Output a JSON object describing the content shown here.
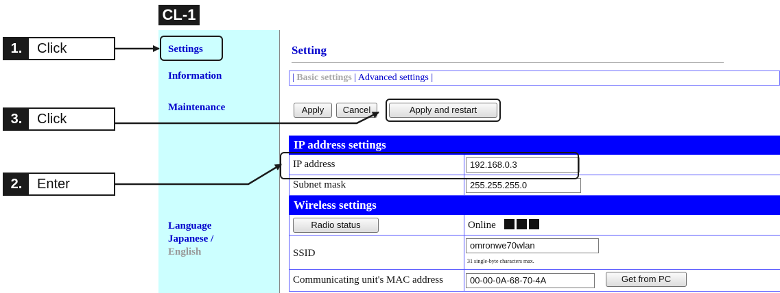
{
  "badge": {
    "label": "CL-1"
  },
  "steps": [
    {
      "num": "1.",
      "text": "Click"
    },
    {
      "num": "3.",
      "text": "Click"
    },
    {
      "num": "2.",
      "text": "Enter"
    }
  ],
  "sidebar": {
    "settings": "Settings",
    "information": "Information",
    "maintenance": "Maintenance",
    "language_label": "Language",
    "japanese": "Japanese",
    "lang_sep": " /",
    "english": "English"
  },
  "main": {
    "title": "Setting",
    "tabs": {
      "basic": "Basic settings",
      "advanced": "Advanced settings",
      "sep_left": "|",
      "sep_mid": " | ",
      "sep_right": " |"
    },
    "buttons": {
      "apply": "Apply",
      "cancel": "Cancel",
      "apply_restart": "Apply and restart"
    }
  },
  "ip_section": {
    "header": "IP address settings",
    "ip_label": "IP address",
    "ip_value": "192.168.0.3",
    "mask_label": "Subnet mask",
    "mask_value": "255.255.255.0"
  },
  "wireless_section": {
    "header": "Wireless settings",
    "radio_button": "Radio status",
    "radio_value": "Online",
    "ssid_label": "SSID",
    "ssid_value": "omronwe70wlan",
    "ssid_hint": "31 single-byte characters max.",
    "mac_label": "Communicating unit's MAC address",
    "mac_value": "00-00-0A-68-70-4A",
    "get_from_pc": "Get from PC"
  }
}
